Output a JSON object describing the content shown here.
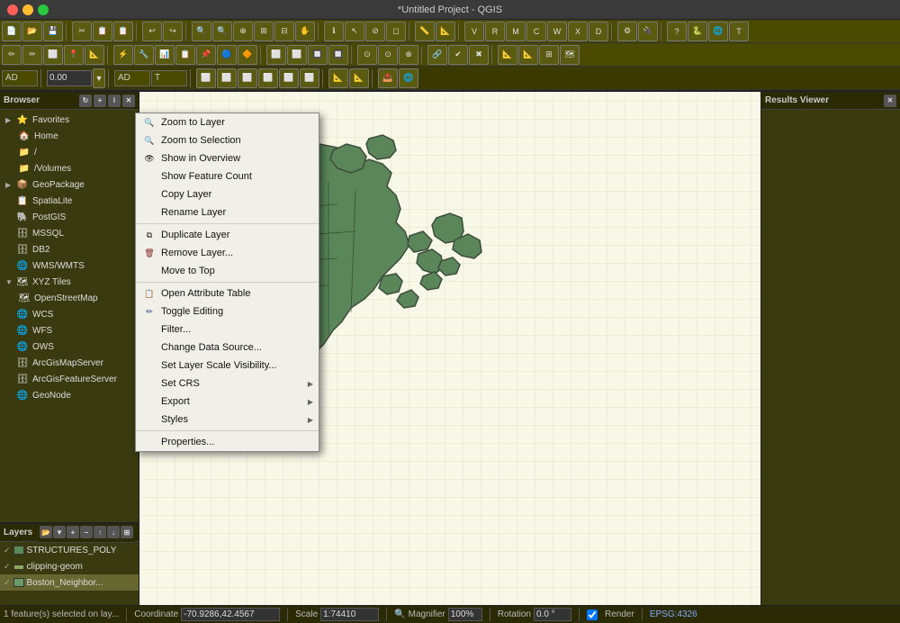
{
  "titlebar": {
    "title": "*Untitled Project - QGIS",
    "controls": [
      "close",
      "minimize",
      "maximize"
    ]
  },
  "toolbar_rows": [
    {
      "id": "row1",
      "buttons": [
        "📁",
        "💾",
        "🖨",
        "✂",
        "📋",
        "📋",
        "↩",
        "↪",
        "💡",
        "🔍",
        "🔍",
        "🔍",
        "🔍",
        "🔍",
        "⚙",
        "🔧",
        "📊",
        "📐",
        "🔵",
        "🔴",
        "⭕",
        "⬜",
        "📍",
        "📌",
        "🔗",
        "✏",
        "📝",
        "🖊",
        "⬜",
        "🔶",
        "🔷",
        "⭕",
        "📏",
        "📐",
        "🔄",
        "📊",
        "⚡",
        "📋",
        "📋",
        "⚙",
        "⚡",
        "🗂",
        "📤",
        "⚙",
        "⚙",
        "📑",
        "🌐",
        "T",
        "T"
      ]
    },
    {
      "id": "row2",
      "buttons": [
        "⬜",
        "⬜",
        "⬜",
        "⬜",
        "⬜",
        "⬜",
        "⬜",
        "⬜",
        "⬜",
        "⬜",
        "⬜",
        "⬜",
        "⬜",
        "⬜",
        "⬜",
        "⬜",
        "⬜",
        "⬜",
        "⬜",
        "⬜",
        "⬜",
        "⬜",
        "⬜",
        "⬜",
        "⬜",
        "⬜",
        "⬜",
        "⬜",
        "⬜",
        "⬜",
        "⬜",
        "⬜",
        "⬜",
        "⬜",
        "⬜",
        "⬜",
        "⬜",
        "⬜",
        "⬜",
        "⬜",
        "⬜",
        "⬜",
        "⬜",
        "⬜",
        "⬜",
        "⬜",
        "⬜",
        "⬜"
      ]
    },
    {
      "id": "row3",
      "items": [
        {
          "type": "label",
          "text": "AD"
        },
        {
          "type": "input",
          "value": "0.00"
        },
        {
          "type": "label",
          "text": "AD"
        },
        {
          "type": "label",
          "text": "T"
        }
      ]
    }
  ],
  "browser": {
    "title": "Browser",
    "items": [
      {
        "id": "favorites",
        "label": "Favorites",
        "icon": "⭐",
        "indent": 0,
        "arrow": "▶"
      },
      {
        "id": "home",
        "label": "Home",
        "icon": "🏠",
        "indent": 1,
        "arrow": ""
      },
      {
        "id": "root",
        "label": "/",
        "icon": "📁",
        "indent": 1,
        "arrow": ""
      },
      {
        "id": "volumes",
        "label": "/Volumes",
        "icon": "📁",
        "indent": 1,
        "arrow": ""
      },
      {
        "id": "geopackage",
        "label": "GeoPackage",
        "icon": "📦",
        "indent": 0,
        "arrow": "▶"
      },
      {
        "id": "spatialite",
        "label": "SpatiaLite",
        "icon": "📋",
        "indent": 0,
        "arrow": ""
      },
      {
        "id": "postgis",
        "label": "PostGIS",
        "icon": "🐘",
        "indent": 0,
        "arrow": ""
      },
      {
        "id": "mssql",
        "label": "MSSQL",
        "icon": "🗄",
        "indent": 0,
        "arrow": ""
      },
      {
        "id": "db2",
        "label": "DB2",
        "icon": "🗄",
        "indent": 0,
        "arrow": ""
      },
      {
        "id": "wmswmts",
        "label": "WMS/WMTS",
        "icon": "🌐",
        "indent": 0,
        "arrow": ""
      },
      {
        "id": "xyztiles",
        "label": "XYZ Tiles",
        "icon": "🗺",
        "indent": 0,
        "arrow": "▼"
      },
      {
        "id": "openstreetmap",
        "label": "OpenStreetMap",
        "icon": "🗺",
        "indent": 1,
        "arrow": ""
      },
      {
        "id": "wcs",
        "label": "WCS",
        "icon": "🌐",
        "indent": 0,
        "arrow": ""
      },
      {
        "id": "wfs",
        "label": "WFS",
        "icon": "🌐",
        "indent": 0,
        "arrow": ""
      },
      {
        "id": "ows",
        "label": "OWS",
        "icon": "🌐",
        "indent": 0,
        "arrow": ""
      },
      {
        "id": "arcgismapserver",
        "label": "ArcGisMapServer",
        "icon": "🗄",
        "indent": 0,
        "arrow": ""
      },
      {
        "id": "arcgisfeatureserver",
        "label": "ArcGisFeatureServer",
        "icon": "🗄",
        "indent": 0,
        "arrow": ""
      },
      {
        "id": "geonode",
        "label": "GeoNode",
        "icon": "🌐",
        "indent": 0,
        "arrow": ""
      }
    ]
  },
  "layers": {
    "title": "Layers",
    "items": [
      {
        "id": "structures",
        "label": "STRUCTURES_POLY",
        "type": "poly",
        "checked": true
      },
      {
        "id": "clipping",
        "label": "clipping-geom",
        "type": "line",
        "checked": true
      },
      {
        "id": "boston",
        "label": "Boston_Neighbor...",
        "type": "fill",
        "checked": true,
        "selected": true
      }
    ]
  },
  "context_menu": {
    "items": [
      {
        "id": "zoom-to-layer",
        "label": "Zoom to Layer",
        "icon": "🔍",
        "type": "item",
        "has_sub": false
      },
      {
        "id": "zoom-to-selection",
        "label": "Zoom to Selection",
        "icon": "🔍",
        "type": "item",
        "has_sub": false
      },
      {
        "id": "show-overview",
        "label": "Show in Overview",
        "icon": "👁",
        "type": "item",
        "has_sub": false
      },
      {
        "id": "show-feature-count",
        "label": "Show Feature Count",
        "icon": "",
        "type": "item",
        "has_sub": false
      },
      {
        "id": "copy-layer",
        "label": "Copy Layer",
        "icon": "",
        "type": "item",
        "has_sub": false
      },
      {
        "id": "rename-layer",
        "label": "Rename Layer",
        "icon": "",
        "type": "item",
        "has_sub": false
      },
      {
        "id": "sep1",
        "type": "sep"
      },
      {
        "id": "duplicate-layer",
        "label": "Duplicate Layer",
        "icon": "",
        "type": "item",
        "has_sub": false
      },
      {
        "id": "remove-layer",
        "label": "Remove Layer...",
        "icon": "🗑",
        "type": "item",
        "has_sub": false
      },
      {
        "id": "move-to-top",
        "label": "Move to Top",
        "icon": "",
        "type": "item",
        "has_sub": false
      },
      {
        "id": "sep2",
        "type": "sep"
      },
      {
        "id": "open-attr-table",
        "label": "Open Attribute Table",
        "icon": "📋",
        "type": "item",
        "has_sub": false
      },
      {
        "id": "toggle-editing",
        "label": "Toggle Editing",
        "icon": "✏",
        "type": "item",
        "has_sub": false
      },
      {
        "id": "filter",
        "label": "Filter...",
        "icon": "",
        "type": "item",
        "has_sub": false
      },
      {
        "id": "change-data-source",
        "label": "Change Data Source...",
        "icon": "",
        "type": "item",
        "has_sub": false
      },
      {
        "id": "set-layer-scale",
        "label": "Set Layer Scale Visibility...",
        "icon": "",
        "type": "item",
        "has_sub": false
      },
      {
        "id": "set-crs",
        "label": "Set CRS",
        "icon": "",
        "type": "item",
        "has_sub": true
      },
      {
        "id": "export",
        "label": "Export",
        "icon": "",
        "type": "item",
        "has_sub": true
      },
      {
        "id": "styles",
        "label": "Styles",
        "icon": "",
        "type": "item",
        "has_sub": true
      },
      {
        "id": "sep3",
        "type": "sep"
      },
      {
        "id": "properties",
        "label": "Properties...",
        "icon": "",
        "type": "item",
        "has_sub": false
      }
    ]
  },
  "results_viewer": {
    "title": "Results Viewer"
  },
  "statusbar": {
    "feature_info": "1 feature(s) selected on lay...",
    "coordinate_label": "Coordinate",
    "coordinate_value": "-70.9286,42.4567",
    "scale_label": "Scale",
    "scale_value": "1:74410",
    "magnifier_label": "Magnifier",
    "magnifier_value": "100%",
    "rotation_label": "Rotation",
    "rotation_value": "0.0 °",
    "render_label": "Render",
    "epsg_label": "EPSG:4326"
  }
}
